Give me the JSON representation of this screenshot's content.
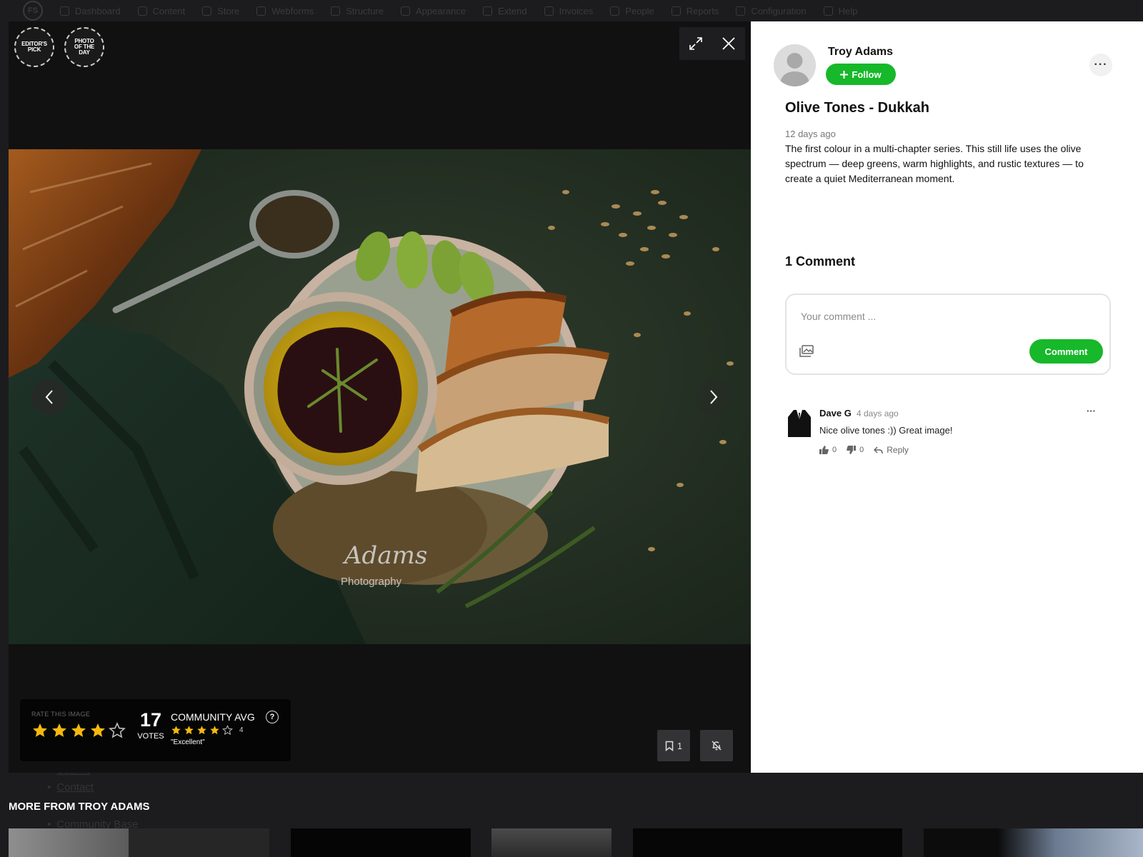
{
  "admin_nav": {
    "items": [
      "Dashboard",
      "Content",
      "Store",
      "Webforms",
      "Structure",
      "Appearance",
      "Extend",
      "Invoices",
      "People",
      "Reports",
      "Configuration",
      "Help"
    ]
  },
  "background_links": [
    "Submit",
    "Contact",
    "Community Base"
  ],
  "viewer": {
    "badges": [
      {
        "label": "EDITOR'S PICK",
        "icon": "laurel-badge-icon"
      },
      {
        "label": "PHOTO OF THE DAY",
        "icon": "laurel-badge-icon"
      }
    ],
    "tools": {
      "expand_icon": "expand-icon",
      "close_icon": "close-icon"
    },
    "photo": {
      "watermark_script": "Adams",
      "watermark_text": "Photography"
    },
    "rating": {
      "label": "RATE THIS IMAGE",
      "user_stars": 4,
      "max_stars": 5,
      "votes": "17",
      "votes_label": "VOTES",
      "community_label": "COMMUNITY AVG",
      "community_stars": 4,
      "community_count": "4",
      "community_text": "\"Excellent\"",
      "help": "?"
    },
    "bookmark_count": "1",
    "colors": {
      "star": "#f5b90f",
      "accent": "#17b82a"
    }
  },
  "panel": {
    "author": "Troy Adams",
    "follow_label": "Follow",
    "title": "Olive Tones - Dukkah",
    "posted": "12 days ago",
    "description": "The first colour in a multi-chapter series. This still life uses the olive spectrum — deep greens, warm highlights, and rustic textures — to create a quiet Mediterranean moment.",
    "comments_heading": "1 Comment",
    "comment_placeholder": "Your comment ...",
    "comment_button": "Comment",
    "comments": [
      {
        "author": "Dave G",
        "time": "4 days ago",
        "text": "Nice olive tones :)) Great image!",
        "likes": "0",
        "dislikes": "0",
        "reply_label": "Reply"
      }
    ]
  },
  "more_from": {
    "heading": "MORE FROM TROY ADAMS"
  }
}
